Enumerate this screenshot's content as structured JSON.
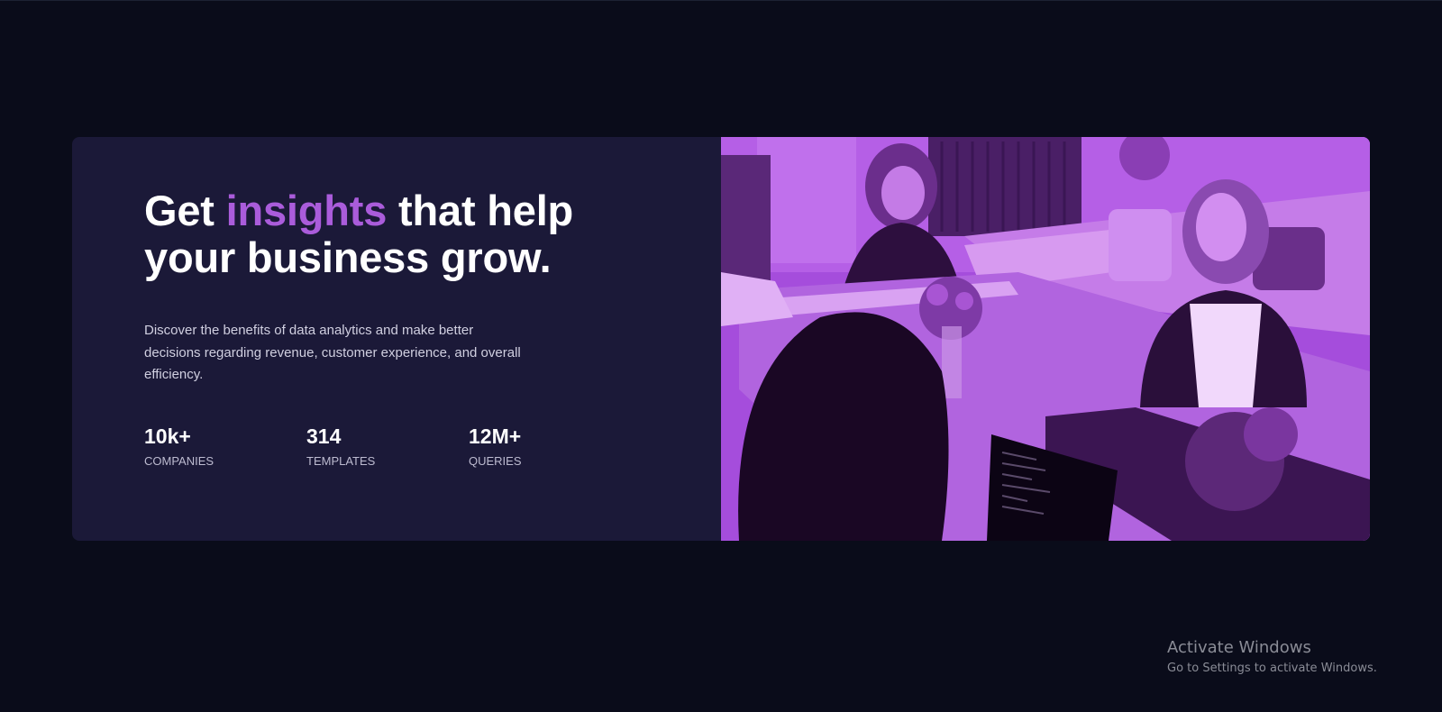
{
  "hero": {
    "headline_before": "Get ",
    "headline_accent": "insights",
    "headline_after": " that help your business grow.",
    "description": "Discover the benefits of data analytics and make better decisions regarding revenue, customer experience, and overall efficiency.",
    "stats": [
      {
        "value": "10k+",
        "label": "COMPANIES"
      },
      {
        "value": "314",
        "label": "TEMPLATES"
      },
      {
        "value": "12M+",
        "label": "QUERIES"
      }
    ]
  },
  "colors": {
    "page_background": "#0a0c1a",
    "card_background": "#1b1938",
    "accent": "#aa5cdb",
    "image_overlay": "#a64dde"
  },
  "watermark": {
    "title": "Activate Windows",
    "subtitle": "Go to Settings to activate Windows."
  }
}
